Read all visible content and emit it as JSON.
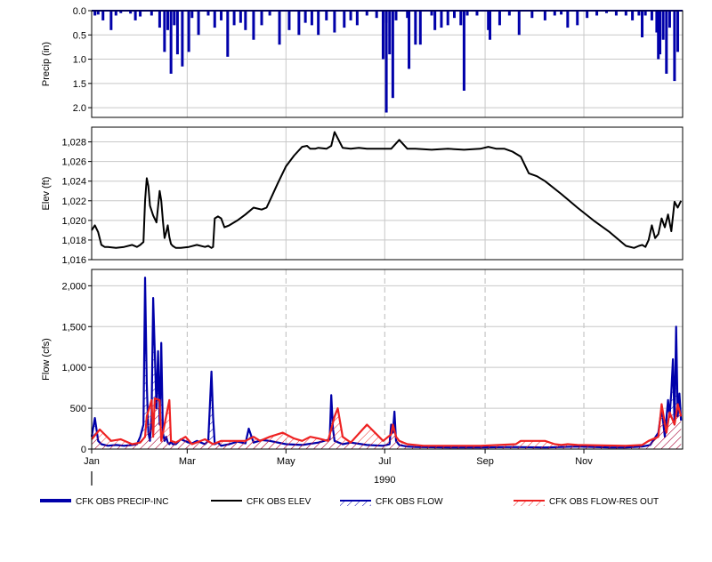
{
  "chart_data": [
    {
      "type": "bar",
      "ylabel": "Precip (in)",
      "ylim": [
        0,
        2.2
      ],
      "inverted": true,
      "yticks": [
        "0.0",
        "0.5",
        "1.0",
        "1.5",
        "2.0"
      ],
      "grid": true,
      "series": [
        {
          "name": "CFK OBS PRECIP-INC",
          "color": "#0000aa",
          "x": [
            2,
            4,
            7,
            12,
            15,
            18,
            24,
            27,
            30,
            37,
            42,
            45,
            47,
            49,
            51,
            53,
            56,
            60,
            62,
            66,
            72,
            76,
            80,
            84,
            88,
            92,
            95,
            100,
            105,
            110,
            116,
            122,
            128,
            132,
            136,
            140,
            145,
            150,
            156,
            160,
            164,
            170,
            176,
            182,
            188,
            195,
            203,
            210,
            216,
            220,
            224,
            228,
            232,
            238,
            245,
            252,
            258,
            264,
            272,
            280,
            286,
            290,
            294,
            300,
            306,
            312,
            318,
            324,
            330,
            334,
            338,
            342,
            346,
            349,
            351,
            353,
            355,
            357,
            360,
            362
          ],
          "values": [
            0.1,
            0.08,
            0.2,
            0.4,
            0.1,
            0.05,
            0.06,
            0.2,
            0.12,
            0.1,
            0.35,
            0.85,
            0.4,
            1.3,
            0.3,
            0.9,
            1.15,
            0.85,
            0.15,
            0.5,
            0.1,
            0.35,
            0.2,
            0.95,
            0.3,
            0.25,
            0.4,
            0.6,
            0.3,
            0.1,
            0.7,
            0.4,
            0.5,
            0.25,
            0.3,
            0.5,
            0.2,
            0.45,
            0.35,
            0.2,
            0.3,
            0.1,
            0.15,
            0.25,
            0.2,
            0.15,
            0.7,
            0.1,
            0.35,
            0.3,
            0.15,
            0.3,
            0.1,
            0.1,
            0.4,
            0.3,
            0.1,
            0.5,
            0.15,
            0.2,
            0.1,
            0.08,
            0.35,
            0.3,
            0.15,
            0.1,
            0.05,
            0.1,
            0.1,
            0.2,
            0.1,
            0.1,
            0.2,
            0.45,
            0.9,
            0.6,
            1.3,
            0.35,
            1.45,
            0.85
          ]
        },
        {
          "name": "CFK OBS PRECIP-INC",
          "color": "#0000aa",
          "x": [
            180,
            182,
            184,
            186,
            196,
            200,
            212,
            230,
            246,
            340,
            350
          ],
          "values": [
            1.0,
            2.1,
            0.9,
            1.8,
            1.2,
            0.7,
            0.4,
            1.65,
            0.6,
            0.55,
            1.0
          ]
        }
      ]
    },
    {
      "type": "line",
      "ylabel": "Elev (ft)",
      "ylim": [
        1016,
        1029.5
      ],
      "yticks": [
        "1,016",
        "1,018",
        "1,020",
        "1,022",
        "1,024",
        "1,026",
        "1,028"
      ],
      "grid": true,
      "series": [
        {
          "name": "CFK OBS ELEV",
          "color": "#000000",
          "x": [
            0,
            2,
            4,
            6,
            8,
            10,
            15,
            20,
            25,
            28,
            30,
            32,
            33,
            34,
            35,
            36,
            38,
            40,
            42,
            43,
            44,
            45,
            46,
            47,
            48,
            49,
            50,
            52,
            55,
            60,
            65,
            70,
            72,
            74,
            75,
            76,
            78,
            80,
            82,
            85,
            90,
            95,
            100,
            105,
            108,
            110,
            115,
            120,
            125,
            130,
            133,
            135,
            138,
            140,
            145,
            148,
            150,
            155,
            160,
            165,
            170,
            175,
            180,
            185,
            190,
            195,
            200,
            210,
            220,
            230,
            240,
            245,
            250,
            255,
            260,
            265,
            270,
            275,
            280,
            290,
            300,
            310,
            320,
            330,
            335,
            338,
            340,
            342,
            344,
            346,
            348,
            350,
            352,
            354,
            356,
            358,
            360,
            362,
            364
          ],
          "values": [
            1019.0,
            1019.5,
            1018.8,
            1017.5,
            1017.3,
            1017.3,
            1017.2,
            1017.3,
            1017.5,
            1017.3,
            1017.5,
            1017.8,
            1022.0,
            1024.3,
            1023.5,
            1021.5,
            1020.5,
            1019.8,
            1023.0,
            1022.0,
            1020.0,
            1018.2,
            1018.8,
            1019.5,
            1018.3,
            1017.6,
            1017.4,
            1017.2,
            1017.2,
            1017.3,
            1017.5,
            1017.3,
            1017.4,
            1017.2,
            1017.3,
            1020.2,
            1020.4,
            1020.2,
            1019.3,
            1019.5,
            1020.0,
            1020.6,
            1021.3,
            1021.1,
            1021.3,
            1022.0,
            1023.8,
            1025.5,
            1026.6,
            1027.5,
            1027.6,
            1027.3,
            1027.3,
            1027.4,
            1027.3,
            1027.6,
            1029.0,
            1027.4,
            1027.3,
            1027.4,
            1027.3,
            1027.3,
            1027.3,
            1027.3,
            1028.2,
            1027.3,
            1027.3,
            1027.2,
            1027.3,
            1027.2,
            1027.3,
            1027.5,
            1027.3,
            1027.3,
            1027.0,
            1026.5,
            1024.8,
            1024.5,
            1024.0,
            1022.7,
            1021.3,
            1020.0,
            1018.8,
            1017.4,
            1017.2,
            1017.4,
            1017.5,
            1017.3,
            1018.0,
            1019.5,
            1018.2,
            1018.6,
            1020.2,
            1019.3,
            1020.6,
            1018.9,
            1021.9,
            1021.3,
            1022.0
          ]
        }
      ]
    },
    {
      "type": "line",
      "ylabel": "Flow (cfs)",
      "xlabel": "1990",
      "ylim": [
        0,
        2200
      ],
      "yticks": [
        "0",
        "500",
        "1,000",
        "1,500",
        "2,000"
      ],
      "xticks": [
        "Jan",
        "Mar",
        "May",
        "Jul",
        "Sep",
        "Nov"
      ],
      "xtick_days": [
        0,
        59,
        120,
        181,
        243,
        304
      ],
      "xlim": [
        0,
        365
      ],
      "grid": true,
      "series": [
        {
          "name": "CFK OBS FLOW",
          "color": "#0000aa",
          "x": [
            0,
            2,
            4,
            6,
            10,
            15,
            20,
            25,
            28,
            30,
            32,
            33,
            34,
            35,
            36,
            37,
            38,
            40,
            41,
            42,
            43,
            44,
            45,
            46,
            47,
            48,
            49,
            50,
            52,
            55,
            60,
            62,
            65,
            70,
            72,
            74,
            75,
            76,
            78,
            80,
            85,
            90,
            95,
            97,
            100,
            105,
            110,
            120,
            130,
            140,
            147,
            148,
            149,
            150,
            155,
            160,
            170,
            180,
            184,
            185,
            186,
            187,
            188,
            190,
            195,
            200,
            220,
            240,
            260,
            280,
            300,
            320,
            330,
            340,
            345,
            350,
            352,
            354,
            356,
            357,
            358,
            359,
            360,
            361,
            362,
            363,
            364
          ],
          "values": [
            150,
            380,
            100,
            60,
            40,
            50,
            40,
            50,
            60,
            150,
            300,
            2100,
            800,
            200,
            100,
            400,
            1850,
            500,
            1200,
            300,
            1300,
            200,
            100,
            150,
            80,
            60,
            90,
            60,
            60,
            120,
            80,
            70,
            100,
            60,
            100,
            950,
            400,
            60,
            80,
            40,
            60,
            90,
            70,
            250,
            80,
            110,
            100,
            60,
            50,
            80,
            120,
            660,
            250,
            100,
            60,
            80,
            50,
            40,
            60,
            300,
            200,
            460,
            100,
            50,
            30,
            25,
            20,
            20,
            25,
            20,
            30,
            20,
            20,
            30,
            50,
            200,
            500,
            150,
            600,
            400,
            700,
            1100,
            300,
            1500,
            400,
            680,
            350
          ]
        },
        {
          "name": "CFK OBS FLOW-RES OUT",
          "color": "#ee2222",
          "x": [
            0,
            5,
            8,
            12,
            18,
            25,
            30,
            33,
            34,
            37,
            38,
            39,
            42,
            43,
            48,
            49,
            52,
            58,
            62,
            70,
            75,
            80,
            95,
            100,
            104,
            110,
            118,
            125,
            130,
            135,
            140,
            146,
            150,
            152,
            155,
            160,
            170,
            180,
            185,
            186,
            188,
            190,
            195,
            205,
            240,
            262,
            265,
            280,
            286,
            290,
            294,
            300,
            330,
            340,
            344,
            350,
            352,
            355,
            357,
            360,
            362,
            364
          ],
          "values": [
            120,
            240,
            180,
            100,
            120,
            60,
            80,
            150,
            400,
            600,
            150,
            620,
            600,
            100,
            600,
            100,
            80,
            150,
            60,
            120,
            60,
            100,
            100,
            150,
            100,
            150,
            200,
            130,
            100,
            150,
            130,
            100,
            400,
            500,
            150,
            80,
            300,
            100,
            180,
            300,
            150,
            100,
            60,
            40,
            40,
            60,
            100,
            100,
            60,
            50,
            60,
            50,
            40,
            50,
            100,
            150,
            550,
            200,
            450,
            300,
            550,
            400
          ]
        }
      ]
    }
  ],
  "legend": [
    {
      "label": "CFK OBS PRECIP-INC",
      "style": "thick-line",
      "color": "#0000aa"
    },
    {
      "label": "CFK OBS ELEV",
      "style": "line",
      "color": "#000000"
    },
    {
      "label": "CFK OBS FLOW",
      "style": "hatched",
      "color": "#0000aa"
    },
    {
      "label": "CFK OBS FLOW-RES OUT",
      "style": "hatched",
      "color": "#ee2222"
    }
  ]
}
